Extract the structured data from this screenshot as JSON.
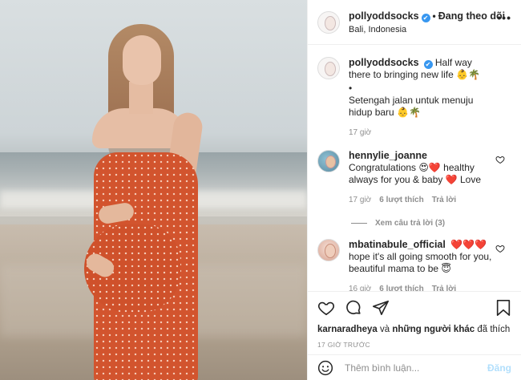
{
  "header": {
    "username": "pollyoddsocks",
    "separator": "•",
    "follow_status": "Đang theo dõi",
    "location": "Bali, Indonesia",
    "more": "•••"
  },
  "caption": {
    "username": "pollyoddsocks",
    "text_en": "Half way there to bringing new life 👶🌴",
    "bullet": "•",
    "text_id": "Setengah jalan untuk menuju hidup baru 👶🌴",
    "time": "17 giờ"
  },
  "comments": [
    {
      "username": "hennylie_joanne",
      "text": "Congratulations 😍❤️ healthy always for you & baby ❤️ Love",
      "time": "17 giờ",
      "likes": "6 lượt thích",
      "reply": "Trả lời",
      "view_replies": "Xem câu trả lời (3)"
    },
    {
      "username": "mbatinabule_official",
      "text": "❤️❤️❤️ hope it's all going smooth for you, beautiful mama to be 😇",
      "time": "16 giờ",
      "likes": "6 lượt thích",
      "reply": "Trả lời"
    }
  ],
  "actions": {
    "liked_by_user": "karnaradheya",
    "liked_by_connector": "và",
    "liked_by_others": "những người khác",
    "liked_by_suffix": "đã thích",
    "timestamp": "17 GIỜ TRƯỚC"
  },
  "add_comment": {
    "placeholder": "Thêm bình luận...",
    "post_label": "Đăng"
  },
  "icons": {
    "verified": "✔",
    "like": "heart-icon",
    "comment": "comment-icon",
    "share": "paper-plane-icon",
    "save": "bookmark-icon",
    "emoji": "smiley-icon"
  },
  "colors": {
    "verified_blue": "#3897f0",
    "post_button_disabled": "#b2dffc",
    "muted_text": "#8e8e8e",
    "dress_red": "#d2542e"
  }
}
